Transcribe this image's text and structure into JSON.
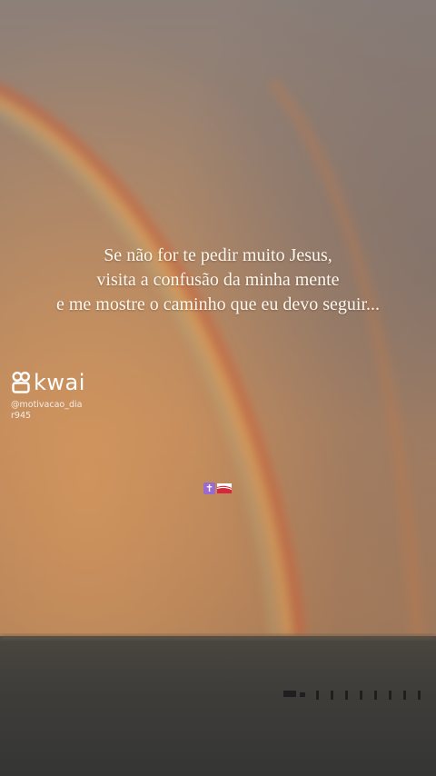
{
  "quote": {
    "line1": "Se não for te pedir muito Jesus,",
    "line2": "visita a confusão da minha mente",
    "line3": "e me mostre o caminho que eu devo seguir..."
  },
  "watermark": {
    "brand": "kwai",
    "handle": "@motivacao_diar945",
    "logo_icon": "kwai-logo-icon"
  },
  "emoji": {
    "cross": "✝",
    "flag_icon": "flag-icon"
  },
  "colors": {
    "sky_top": "#8e8278",
    "sky_warm": "#c58a5a",
    "sea": "#3f3f3d",
    "text": "#fff8ee"
  }
}
